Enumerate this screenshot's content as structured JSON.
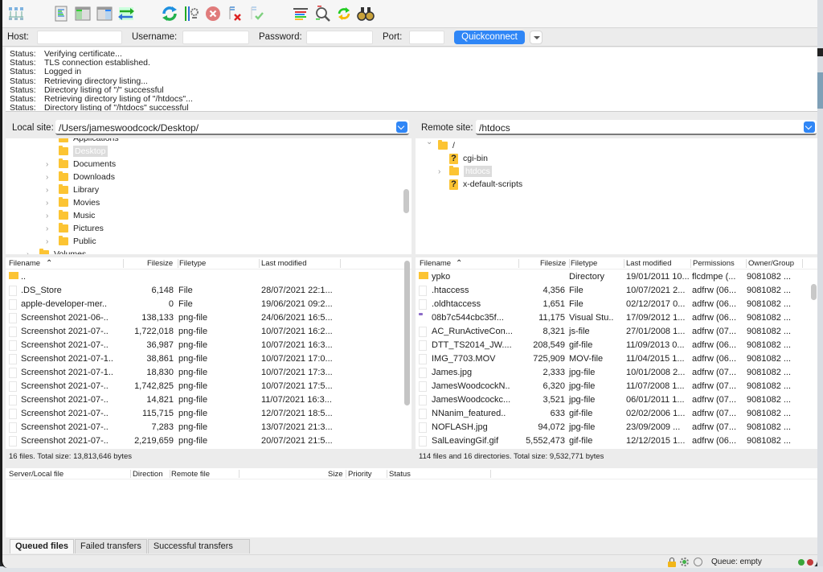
{
  "toolbar": {
    "icons": [
      "site-manager",
      "toggle-message-log",
      "toggle-local-tree",
      "toggle-remote-tree",
      "toggle-transfer-queue",
      "refresh",
      "process-queue",
      "cancel",
      "disconnect",
      "reconnect",
      "directory-listing-filters",
      "compare-directories",
      "synchronized-browsing",
      "search-remote-files"
    ]
  },
  "quickconnect": {
    "host_label": "Host:",
    "host_value": "",
    "username_label": "Username:",
    "username_value": "",
    "password_label": "Password:",
    "password_value": "",
    "port_label": "Port:",
    "port_value": "",
    "button_label": "Quickconnect"
  },
  "log": [
    {
      "k": "Status:",
      "v": "Verifying certificate..."
    },
    {
      "k": "Status:",
      "v": "TLS connection established."
    },
    {
      "k": "Status:",
      "v": "Logged in"
    },
    {
      "k": "Status:",
      "v": "Retrieving directory listing..."
    },
    {
      "k": "Status:",
      "v": "Directory listing of \"/\" successful"
    },
    {
      "k": "Status:",
      "v": "Retrieving directory listing of \"/htdocs\"..."
    },
    {
      "k": "Status:",
      "v": "Directory listing of \"/htdocs\" successful"
    }
  ],
  "local": {
    "site_label": "Local site:",
    "site_path": "/Users/jameswoodcock/Desktop/",
    "tree": [
      {
        "label": "Applications",
        "partial": true
      },
      {
        "label": "Desktop",
        "selected": true
      },
      {
        "label": "Documents"
      },
      {
        "label": "Downloads"
      },
      {
        "label": "Library"
      },
      {
        "label": "Movies"
      },
      {
        "label": "Music"
      },
      {
        "label": "Pictures"
      },
      {
        "label": "Public"
      },
      {
        "label": "Volumes",
        "partial": true
      }
    ],
    "columns": [
      "Filename",
      "Filesize",
      "Filetype",
      "Last modified"
    ],
    "files": [
      {
        "name": "..",
        "size": "",
        "type": "",
        "modified": "",
        "kind": "folder"
      },
      {
        "name": ".DS_Store",
        "size": "6,148",
        "type": "File",
        "modified": "28/07/2021 22:1..."
      },
      {
        "name": "apple-developer-mer..",
        "size": "0",
        "type": "File",
        "modified": "19/06/2021 09:2..."
      },
      {
        "name": "Screenshot 2021-06-..",
        "size": "138,133",
        "type": "png-file",
        "modified": "24/06/2021 16:5..."
      },
      {
        "name": "Screenshot 2021-07-..",
        "size": "1,722,018",
        "type": "png-file",
        "modified": "10/07/2021 16:2..."
      },
      {
        "name": "Screenshot 2021-07-..",
        "size": "36,987",
        "type": "png-file",
        "modified": "10/07/2021 16:3..."
      },
      {
        "name": "Screenshot 2021-07-1..",
        "size": "38,861",
        "type": "png-file",
        "modified": "10/07/2021 17:0..."
      },
      {
        "name": "Screenshot 2021-07-1..",
        "size": "18,830",
        "type": "png-file",
        "modified": "10/07/2021 17:3..."
      },
      {
        "name": "Screenshot 2021-07-..",
        "size": "1,742,825",
        "type": "png-file",
        "modified": "10/07/2021 17:5..."
      },
      {
        "name": "Screenshot 2021-07-..",
        "size": "14,821",
        "type": "png-file",
        "modified": "11/07/2021 16:3..."
      },
      {
        "name": "Screenshot 2021-07-..",
        "size": "115,715",
        "type": "png-file",
        "modified": "12/07/2021 18:5..."
      },
      {
        "name": "Screenshot 2021-07-..",
        "size": "7,283",
        "type": "png-file",
        "modified": "13/07/2021 21:3..."
      },
      {
        "name": "Screenshot 2021-07-..",
        "size": "2,219,659",
        "type": "png-file",
        "modified": "20/07/2021 21:5..."
      }
    ],
    "summary": "16 files. Total size: 13,813,646 bytes"
  },
  "remote": {
    "site_label": "Remote site:",
    "site_path": "/htdocs",
    "tree": [
      {
        "label": "/",
        "kind": "folder",
        "expanded": true
      },
      {
        "label": "cgi-bin",
        "kind": "unknown"
      },
      {
        "label": "htdocs",
        "kind": "folder",
        "selected": true
      },
      {
        "label": "x-default-scripts",
        "kind": "unknown"
      }
    ],
    "columns": [
      "Filename",
      "Filesize",
      "Filetype",
      "Last modified",
      "Permissions",
      "Owner/Group"
    ],
    "files": [
      {
        "name": "ypko",
        "size": "",
        "type": "Directory",
        "modified": "19/01/2011 10...",
        "perms": "flcdmpe (...",
        "owner": "9081082 ...",
        "kind": "folder"
      },
      {
        "name": ".htaccess",
        "size": "4,356",
        "type": "File",
        "modified": "10/07/2021 2...",
        "perms": "adfrw (06...",
        "owner": "9081082 ..."
      },
      {
        "name": ".oldhtaccess",
        "size": "1,651",
        "type": "File",
        "modified": "02/12/2017 0...",
        "perms": "adfrw (06...",
        "owner": "9081082 ..."
      },
      {
        "name": "08b7c544cbc35f...",
        "size": "11,175",
        "type": "Visual Stu..",
        "modified": "17/09/2012 1...",
        "perms": "adfrw (06...",
        "owner": "9081082 ...",
        "kind": "vs"
      },
      {
        "name": "AC_RunActiveCon...",
        "size": "8,321",
        "type": "js-file",
        "modified": "27/01/2008 1...",
        "perms": "adfrw (07...",
        "owner": "9081082 ..."
      },
      {
        "name": "DTT_TS2014_JW....",
        "size": "208,549",
        "type": "gif-file",
        "modified": "11/09/2013 0...",
        "perms": "adfrw (06...",
        "owner": "9081082 ..."
      },
      {
        "name": "IMG_7703.MOV",
        "size": "725,909",
        "type": "MOV-file",
        "modified": "11/04/2015 1...",
        "perms": "adfrw (06...",
        "owner": "9081082 ..."
      },
      {
        "name": "James.jpg",
        "size": "2,333",
        "type": "jpg-file",
        "modified": "10/01/2008 2...",
        "perms": "adfrw (07...",
        "owner": "9081082 ..."
      },
      {
        "name": "JamesWoodcockN..",
        "size": "6,320",
        "type": "jpg-file",
        "modified": "11/07/2008 1...",
        "perms": "adfrw (07...",
        "owner": "9081082 ..."
      },
      {
        "name": "JamesWoodcockc...",
        "size": "3,521",
        "type": "jpg-file",
        "modified": "06/01/2011 1...",
        "perms": "adfrw (07...",
        "owner": "9081082 ..."
      },
      {
        "name": "NNanim_featured..",
        "size": "633",
        "type": "gif-file",
        "modified": "02/02/2006 1...",
        "perms": "adfrw (07...",
        "owner": "9081082 ..."
      },
      {
        "name": "NOFLASH.jpg",
        "size": "94,072",
        "type": "jpg-file",
        "modified": "23/09/2009 ...",
        "perms": "adfrw (07...",
        "owner": "9081082 ..."
      },
      {
        "name": "SalLeavingGif.gif",
        "size": "5,552,473",
        "type": "gif-file",
        "modified": "12/12/2015 1...",
        "perms": "adfrw (06...",
        "owner": "9081082 ..."
      }
    ],
    "summary": "114 files and 16 directories. Total size: 9,532,771 bytes"
  },
  "queue": {
    "columns": [
      "Server/Local file",
      "Direction",
      "Remote file",
      "Size",
      "Priority",
      "Status"
    ],
    "tabs": [
      "Queued files",
      "Failed transfers",
      "Successful transfers"
    ],
    "active_tab": 0
  },
  "statusbar": {
    "queue_text": "Queue: empty"
  },
  "colors": {
    "accent": "#2f86f6",
    "folder": "#fcc433",
    "led_green": "#3aa63a",
    "led_red": "#c23b3b"
  }
}
